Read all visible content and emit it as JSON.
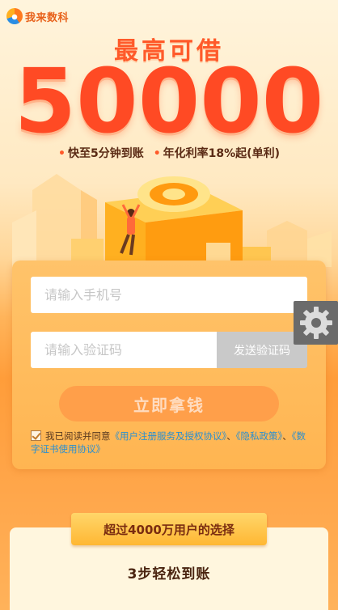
{
  "brand": {
    "logo_text": "我来数科",
    "logo_icon": "brand-logo-icon"
  },
  "hero": {
    "headline": "最高可借",
    "amount": "50000",
    "features": [
      "快至5分钟到账",
      "年化利率18%起(单利)"
    ]
  },
  "form": {
    "phone_placeholder": "请输入手机号",
    "code_placeholder": "请输入验证码",
    "send_code_label": "发送验证码",
    "submit_label": "立即拿钱",
    "agreement": {
      "prefix": "我已阅读并同意",
      "link1": "《用户注册服务及授权协议》",
      "sep1": "、",
      "link2": "《隐私政策》",
      "sep2": "、",
      "link3": "《数字证书使用协议》",
      "checked": true
    }
  },
  "floating": {
    "settings_icon": "gear-icon"
  },
  "bottom": {
    "ribbon": "超过4000万用户的选择",
    "steps_title": "3步轻松到账"
  },
  "colors": {
    "accent": "#ff5a2a",
    "link": "#2a8fd0",
    "card": "#ffb551"
  }
}
